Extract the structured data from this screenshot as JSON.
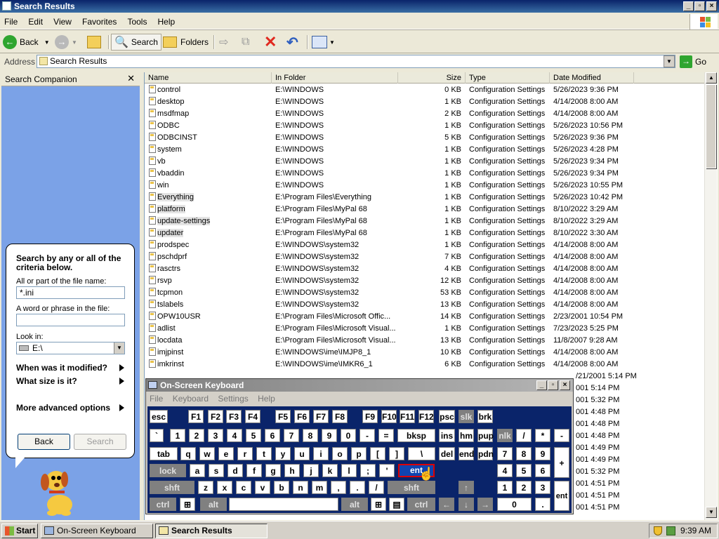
{
  "window": {
    "title": "Search Results"
  },
  "menus": [
    "File",
    "Edit",
    "View",
    "Favorites",
    "Tools",
    "Help"
  ],
  "toolbar": {
    "back": "Back",
    "search": "Search",
    "folders": "Folders"
  },
  "address": {
    "label": "Address",
    "value": "Search Results",
    "go": "Go"
  },
  "companion": {
    "header": "Search Companion",
    "heading": "Search by any or all of the criteria below.",
    "name_label": "All or part of the file name:",
    "name_value": "*.ini",
    "phrase_label": "A word or phrase in the file:",
    "phrase_value": "",
    "lookin_label": "Look in:",
    "lookin_value": "E:\\",
    "when": "When was it modified?",
    "size": "What size is it?",
    "advanced": "More advanced options",
    "back_btn": "Back",
    "search_btn": "Search"
  },
  "columns": [
    "Name",
    "In Folder",
    "Size",
    "Type",
    "Date Modified"
  ],
  "files": [
    [
      "control",
      "E:\\WINDOWS",
      "0 KB",
      "Configuration Settings",
      "5/26/2023 9:36 PM"
    ],
    [
      "desktop",
      "E:\\WINDOWS",
      "1 KB",
      "Configuration Settings",
      "4/14/2008 8:00 AM"
    ],
    [
      "msdfmap",
      "E:\\WINDOWS",
      "2 KB",
      "Configuration Settings",
      "4/14/2008 8:00 AM"
    ],
    [
      "ODBC",
      "E:\\WINDOWS",
      "1 KB",
      "Configuration Settings",
      "5/26/2023 10:56 PM"
    ],
    [
      "ODBCINST",
      "E:\\WINDOWS",
      "5 KB",
      "Configuration Settings",
      "5/26/2023 9:36 PM"
    ],
    [
      "system",
      "E:\\WINDOWS",
      "1 KB",
      "Configuration Settings",
      "5/26/2023 4:28 PM"
    ],
    [
      "vb",
      "E:\\WINDOWS",
      "1 KB",
      "Configuration Settings",
      "5/26/2023 9:34 PM"
    ],
    [
      "vbaddin",
      "E:\\WINDOWS",
      "1 KB",
      "Configuration Settings",
      "5/26/2023 9:34 PM"
    ],
    [
      "win",
      "E:\\WINDOWS",
      "1 KB",
      "Configuration Settings",
      "5/26/2023 10:55 PM"
    ],
    [
      "Everything",
      "E:\\Program Files\\Everything",
      "1 KB",
      "Configuration Settings",
      "5/26/2023 10:42 PM"
    ],
    [
      "platform",
      "E:\\Program Files\\MyPal 68",
      "1 KB",
      "Configuration Settings",
      "8/10/2022 3:29 AM"
    ],
    [
      "update-settings",
      "E:\\Program Files\\MyPal 68",
      "1 KB",
      "Configuration Settings",
      "8/10/2022 3:29 AM"
    ],
    [
      "updater",
      "E:\\Program Files\\MyPal 68",
      "1 KB",
      "Configuration Settings",
      "8/10/2022 3:30 AM"
    ],
    [
      "prodspec",
      "E:\\WINDOWS\\system32",
      "1 KB",
      "Configuration Settings",
      "4/14/2008 8:00 AM"
    ],
    [
      "pschdprf",
      "E:\\WINDOWS\\system32",
      "7 KB",
      "Configuration Settings",
      "4/14/2008 8:00 AM"
    ],
    [
      "rasctrs",
      "E:\\WINDOWS\\system32",
      "4 KB",
      "Configuration Settings",
      "4/14/2008 8:00 AM"
    ],
    [
      "rsvp",
      "E:\\WINDOWS\\system32",
      "12 KB",
      "Configuration Settings",
      "4/14/2008 8:00 AM"
    ],
    [
      "tcpmon",
      "E:\\WINDOWS\\system32",
      "53 KB",
      "Configuration Settings",
      "4/14/2008 8:00 AM"
    ],
    [
      "tslabels",
      "E:\\WINDOWS\\system32",
      "13 KB",
      "Configuration Settings",
      "4/14/2008 8:00 AM"
    ],
    [
      "OPW10USR",
      "E:\\Program Files\\Microsoft Offic...",
      "14 KB",
      "Configuration Settings",
      "2/23/2001 10:54 PM"
    ],
    [
      "adlist",
      "E:\\Program Files\\Microsoft Visual...",
      "1 KB",
      "Configuration Settings",
      "7/23/2023 5:25 PM"
    ],
    [
      "locdata",
      "E:\\Program Files\\Microsoft Visual...",
      "13 KB",
      "Configuration Settings",
      "11/8/2007 9:28 AM"
    ],
    [
      "imjpinst",
      "E:\\WINDOWS\\ime\\IMJP8_1",
      "10 KB",
      "Configuration Settings",
      "4/14/2008 8:00 AM"
    ],
    [
      "imkrinst",
      "E:\\WINDOWS\\ime\\IMKR6_1",
      "6 KB",
      "Configuration Settings",
      "4/14/2008 8:00 AM"
    ]
  ],
  "hidden_dates": [
    "/21/2001 5:14 PM",
    "001 5:14 PM",
    "001 5:32 PM",
    "001 4:48 PM",
    "001 4:48 PM",
    "001 4:48 PM",
    "001 4:49 PM",
    "001 4:49 PM",
    "001 5:32 PM",
    "001 4:51 PM",
    "001 4:51 PM",
    "001 4:51 PM"
  ],
  "osk": {
    "title": "On-Screen Keyboard",
    "menus": [
      "File",
      "Keyboard",
      "Settings",
      "Help"
    ]
  },
  "taskbar": {
    "start": "Start",
    "tasks": [
      "On-Screen Keyboard",
      "Search Results"
    ],
    "clock": "9:39 AM"
  }
}
